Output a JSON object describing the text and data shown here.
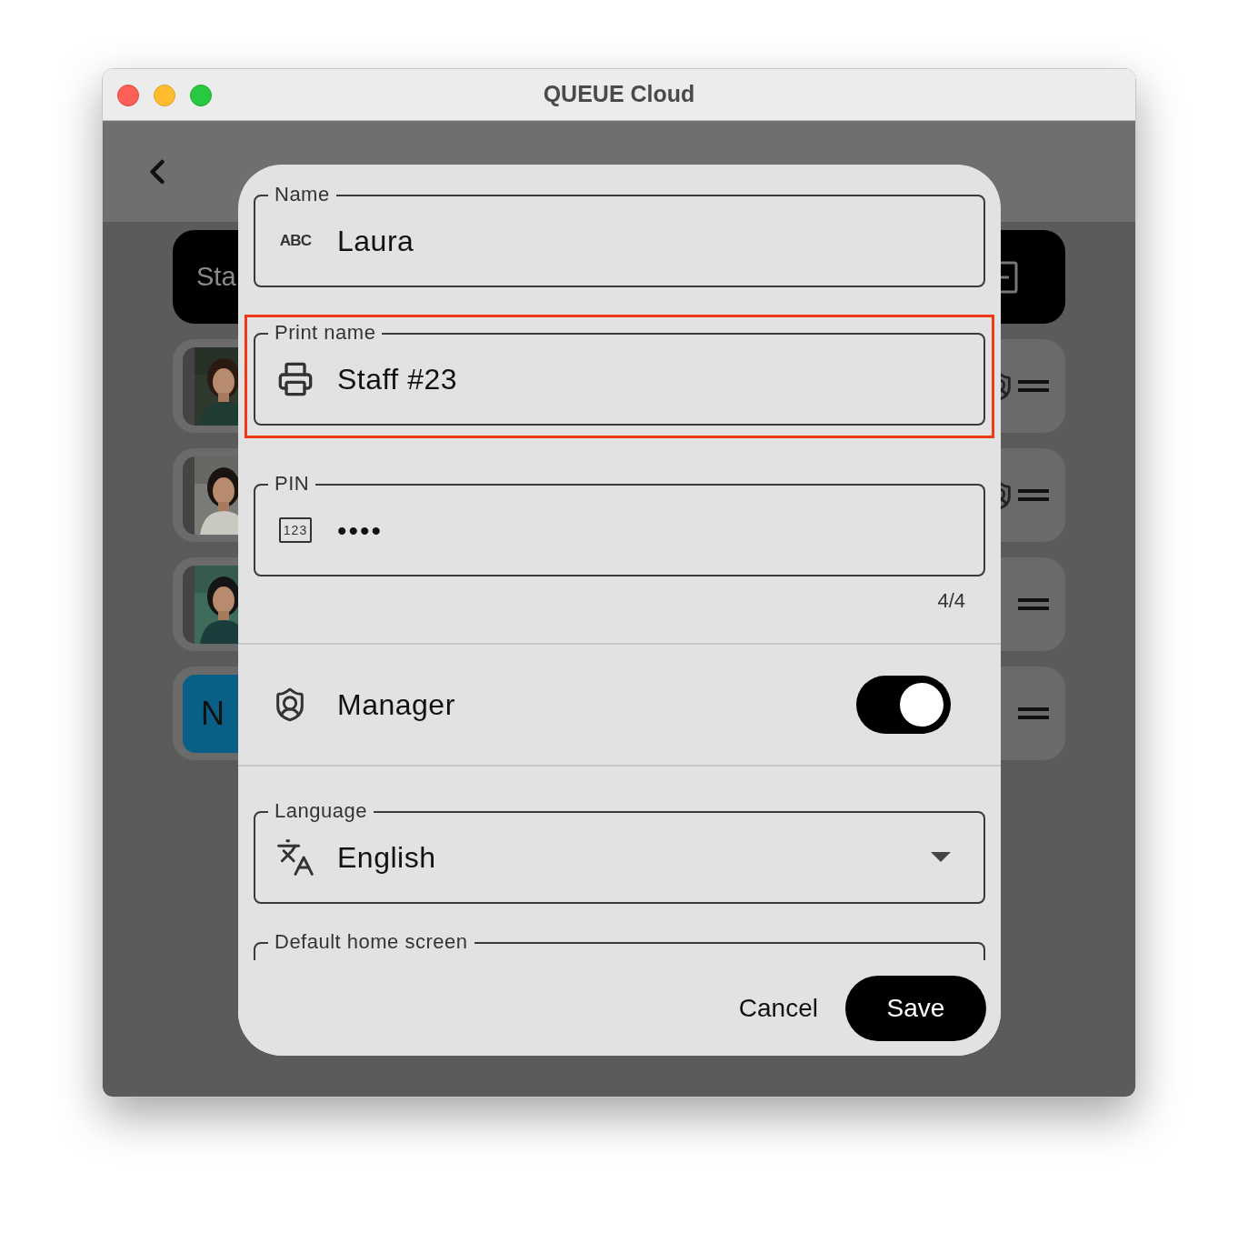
{
  "window": {
    "title": "QUEUE Cloud"
  },
  "screen": {
    "header_card": {
      "label": "Sta"
    },
    "rows": [
      {
        "manager": true
      },
      {
        "manager": true
      },
      {
        "manager": false
      },
      {
        "avatar": {
          "kind": "initial",
          "initial": "N",
          "color": "#0a5f86"
        },
        "manager": false
      }
    ]
  },
  "dialog": {
    "fields": [
      {
        "label": "Name",
        "icon_label": "ABC",
        "value": "Laura",
        "highlighted": false
      },
      {
        "label": "Print name",
        "value": "Staff #23",
        "highlighted": true
      },
      {
        "label": "PIN",
        "icon_label": "123",
        "value": "••••",
        "counter": "4/4",
        "highlighted": false
      }
    ],
    "manager": {
      "label": "Manager",
      "on": true
    },
    "language": {
      "label": "Language",
      "value": "English"
    },
    "home_screen": {
      "label": "Default home screen"
    },
    "buttons": {
      "cancel": "Cancel",
      "save": "Save"
    }
  }
}
